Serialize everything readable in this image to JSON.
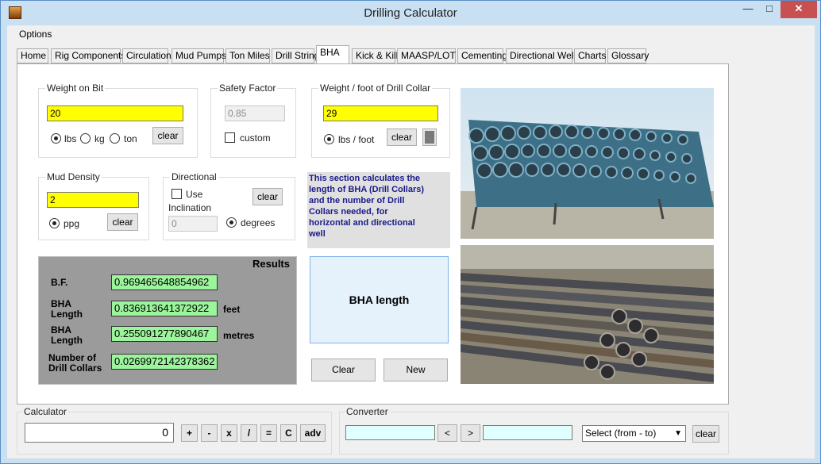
{
  "window": {
    "title": "Drilling Calculator",
    "minimize": "—",
    "maximize": "□",
    "close": "✕"
  },
  "menu": {
    "options": "Options"
  },
  "tabs": [
    "Home",
    "Rig Components",
    "Circulation",
    "Mud Pumps",
    "Ton Miles",
    "Drill String",
    "BHA",
    "Kick & Kill",
    "MAASP/LOT",
    "Cementing",
    "Directional Well",
    "Charts",
    "Glossary"
  ],
  "active_tab": "BHA",
  "weight_on_bit": {
    "label": "Weight on Bit",
    "value": "20",
    "units": [
      "lbs",
      "kg",
      "ton"
    ],
    "selected_unit": "lbs",
    "clear": "clear"
  },
  "safety_factor": {
    "label": "Safety Factor",
    "value": "0.85",
    "custom": "custom"
  },
  "weight_per_foot": {
    "label": "Weight  / foot of Drill Collar",
    "value": "29",
    "unit": "lbs / foot",
    "clear": "clear"
  },
  "mud_density": {
    "label": "Mud Density",
    "value": "2",
    "unit": "ppg",
    "clear": "clear"
  },
  "directional": {
    "label": "Directional",
    "use": "Use",
    "inclination": "Inclination",
    "value": "0",
    "unit": "degrees",
    "clear": "clear"
  },
  "info": {
    "text": "This section calculates the length of BHA (Drill Collars) and the number of Drill Collars needed, for horizontal and directional well"
  },
  "results": {
    "title": "Results",
    "bf_label": "B.F.",
    "bf_value": "0.969465648854962",
    "length_ft_label": "BHA Length",
    "length_ft_value": "0.836913641372922",
    "length_ft_unit": "feet",
    "length_m_label": "BHA Length",
    "length_m_value": "0.255091277890467",
    "length_m_unit": "metres",
    "collars_label": "Number of Drill Collars",
    "collars_value": "0.0269972142378362"
  },
  "bha_button": {
    "label": "BHA length"
  },
  "actions": {
    "clear": "Clear",
    "new": "New"
  },
  "calculator": {
    "label": "Calculator",
    "display": "0",
    "ops": [
      "+",
      "-",
      "x",
      "/",
      "=",
      "C",
      "adv"
    ]
  },
  "converter": {
    "label": "Converter",
    "left": "<",
    "right": ">",
    "select": "Select (from - to)",
    "clear": "clear"
  },
  "colors": {
    "required_field": "#ffff00",
    "result_field": "#9cf59c",
    "info_text": "#1a1a8c",
    "converter_field": "#e0ffff"
  }
}
